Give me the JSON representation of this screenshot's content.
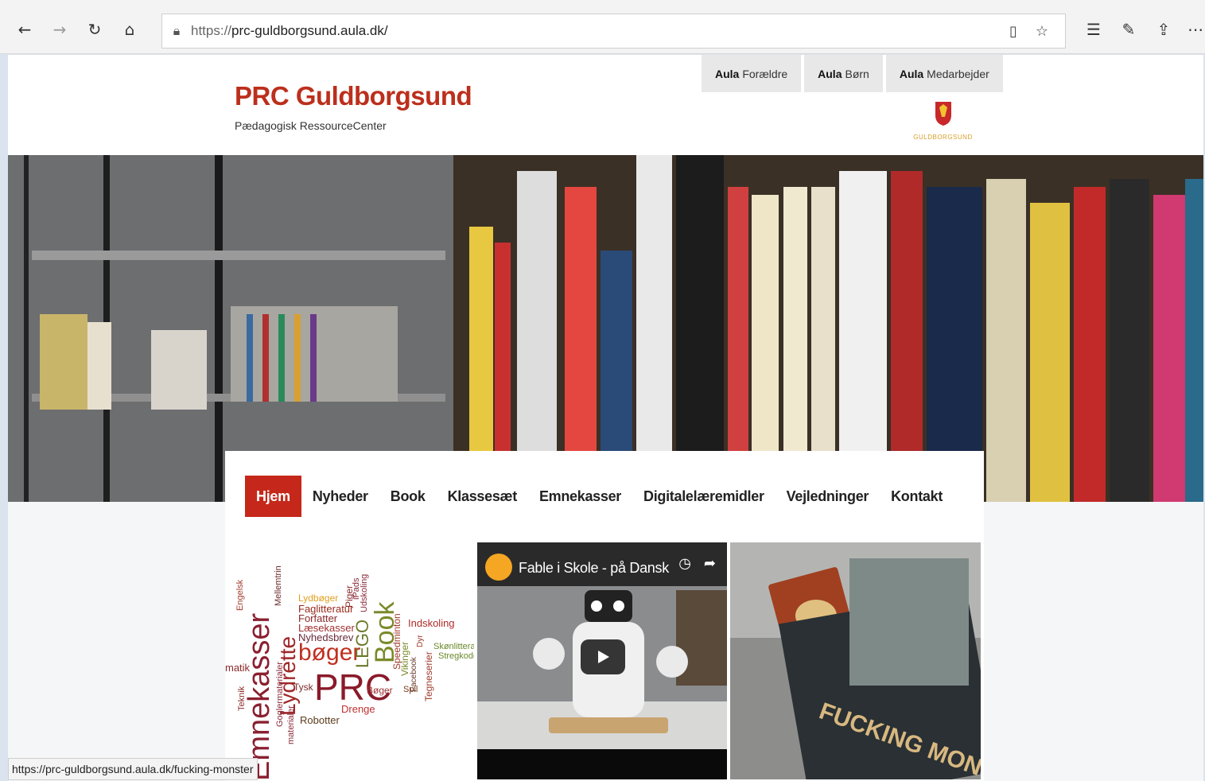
{
  "browser": {
    "url_scheme": "https://",
    "url_rest": "prc-guldborgsund.aula.dk/",
    "icons": [
      "back-icon",
      "forward-icon",
      "refresh-icon",
      "home-icon",
      "lock-icon",
      "reading-view-icon",
      "favorite-star-icon",
      "favorites-list-icon",
      "pen-icon",
      "share-icon",
      "more-icon"
    ]
  },
  "header": {
    "title": "PRC Guldborgsund",
    "subtitle": "Pædagogisk RessourceCenter",
    "logo_text": "GULDBORGSUND",
    "aula_tabs": [
      {
        "brand": "Aula",
        "label": "Forældre"
      },
      {
        "brand": "Aula",
        "label": "Børn"
      },
      {
        "brand": "Aula",
        "label": "Medarbejder"
      }
    ]
  },
  "menu": {
    "items": [
      "Hjem",
      "Nyheder",
      "Book",
      "Klassesæt",
      "Emnekasser",
      "Digitalelæremidler",
      "Vejledninger",
      "Kontakt"
    ],
    "active": "Hjem"
  },
  "video": {
    "title": "Fable i Skole - på Dansk"
  },
  "tiles": {
    "wordcloud_words": [
      "Emnekasser",
      "PRC",
      "Book",
      "bøger",
      "Lydrette",
      "LEGO",
      "Udskoling",
      "Indskoling",
      "Drenge",
      "Robotter",
      "Piger",
      "Faglitteratur",
      "Forfatter",
      "Læsekasser",
      "Nyhedsbrev",
      "Lydbøger",
      "Tysk",
      "Bøger",
      "Spil",
      "Teknik",
      "Engelsk",
      "Mellemtrin",
      "Vikinger",
      "Speedminton",
      "Facebook",
      "Tegneserier",
      "Skønlitteratur",
      "Stregkoder",
      "Goglermaterialer",
      "materialer",
      "iPads",
      "matik",
      "Dyr"
    ],
    "book_title": "FUCKING MONSTER"
  },
  "status_bar": "https://prc-guldborgsund.aula.dk/fucking-monster",
  "colors": {
    "brand_red": "#bc2f1c",
    "menu_active": "#c5281a"
  }
}
